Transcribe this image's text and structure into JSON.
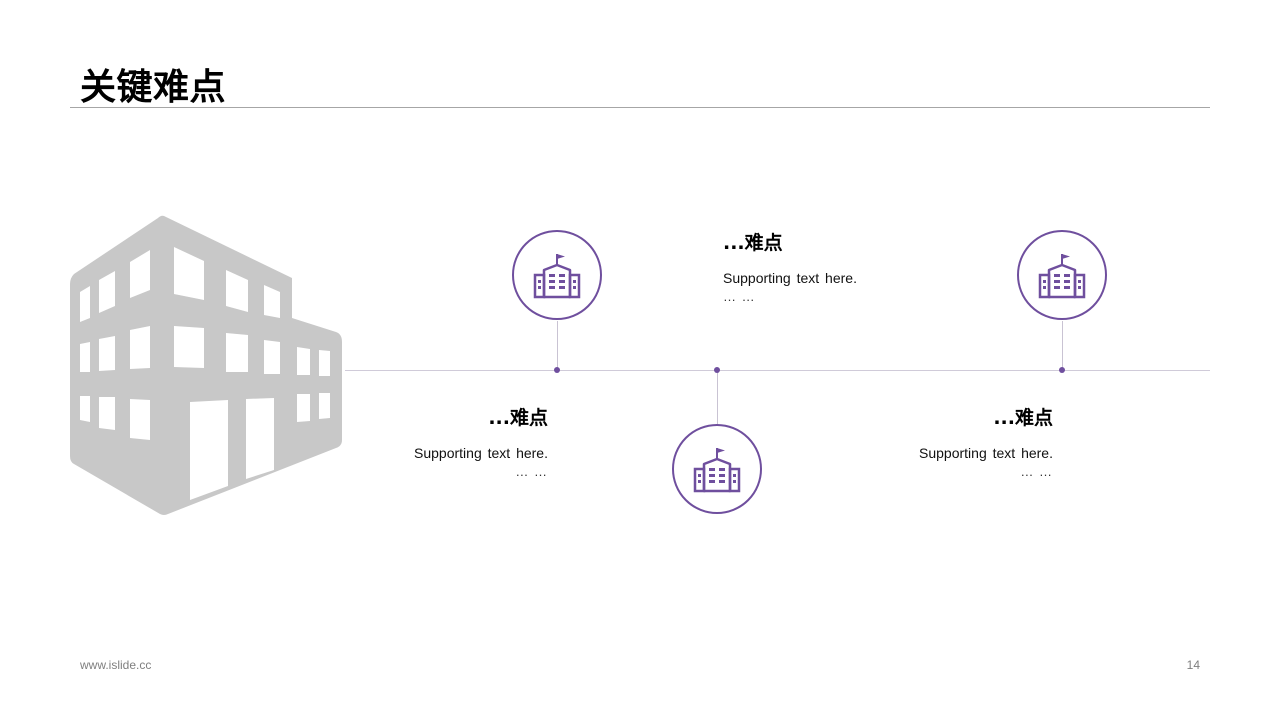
{
  "slide": {
    "title": "关键难点",
    "footer_url": "www.islide.cc",
    "page_number": "14"
  },
  "colors": {
    "accent": "#6f4f9e",
    "building_gray": "#c8c8c8",
    "rule": "#a6a6a6"
  },
  "icons": [
    "building-illustration",
    "school-building-icon"
  ],
  "points": [
    {
      "heading": "...难点",
      "body": "Supporting text here.",
      "more": "… …"
    },
    {
      "heading": "...难点",
      "body": "Supporting text here.",
      "more": "… …"
    },
    {
      "heading": "...难点",
      "body": "Supporting text here.",
      "more": "… …"
    }
  ]
}
